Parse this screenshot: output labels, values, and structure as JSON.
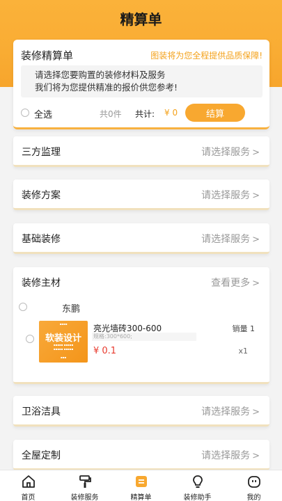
{
  "header": {
    "title": "精算单"
  },
  "summary": {
    "title": "装修精算单",
    "slogan": "图装将为您全程提供品质保障!",
    "note_line1": "请选择您要购置的装修材料及服务",
    "note_line2": "我们将为您提供精准的报价供您参考!",
    "select_all_label": "全选",
    "count_text": "共0件",
    "total_label": "共计:",
    "total_value": "¥ 0",
    "checkout_label": "结算"
  },
  "sections": [
    {
      "label": "三方监理",
      "action": "请选择服务"
    },
    {
      "label": "装修方案",
      "action": "请选择服务"
    },
    {
      "label": "基础装修",
      "action": "请选择服务"
    }
  ],
  "materials": {
    "label": "装修主材",
    "action": "查看更多",
    "store_name": "东鹏",
    "product": {
      "name": "亮光墙砖300-600",
      "spec": "规格:300*600;",
      "price": "¥ 0.1",
      "sales": "销量 1",
      "quantity": "x1",
      "thumb_title": "软装设计"
    }
  },
  "sections_bottom": [
    {
      "label": "卫浴洁具",
      "action": "请选择服务"
    },
    {
      "label": "全屋定制",
      "action": "请选择服务"
    }
  ],
  "chevron": ">",
  "nav": [
    {
      "label": "首页",
      "icon": "home-icon"
    },
    {
      "label": "装修服务",
      "icon": "paint-roller-icon"
    },
    {
      "label": "精算单",
      "icon": "list-icon"
    },
    {
      "label": "装修助手",
      "icon": "lightbulb-icon"
    },
    {
      "label": "我的",
      "icon": "profile-icon"
    }
  ],
  "colors": {
    "accent": "#f8a830",
    "price": "#e83a2e",
    "slogan": "#f4a21b"
  }
}
